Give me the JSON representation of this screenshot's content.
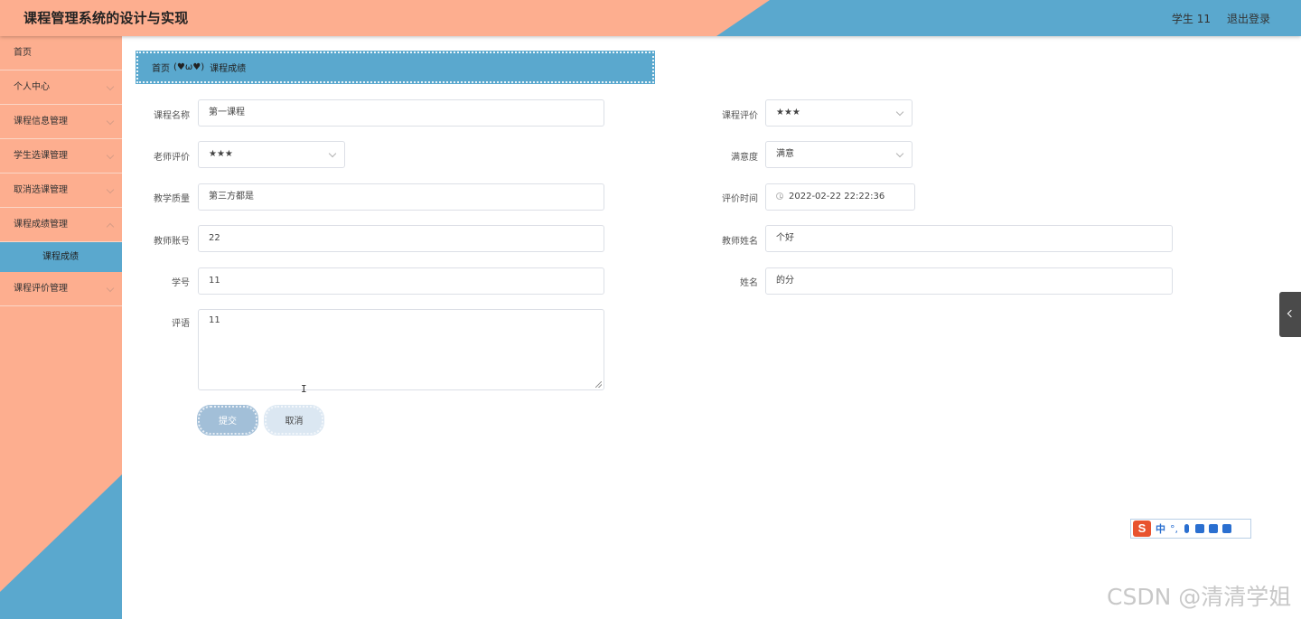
{
  "header": {
    "title": "课程管理系统的设计与实现",
    "user_label": "学生 11",
    "logout_label": "退出登录"
  },
  "sidebar": {
    "items": [
      {
        "label": "首页"
      },
      {
        "label": "个人中心"
      },
      {
        "label": "课程信息管理"
      },
      {
        "label": "学生选课管理"
      },
      {
        "label": "取消选课管理"
      },
      {
        "label": "课程成绩管理"
      },
      {
        "label": "课程成绩"
      },
      {
        "label": "课程评价管理"
      }
    ]
  },
  "breadcrumb": {
    "home": "首页",
    "separator": "(♥ω♥)",
    "current": "课程成绩"
  },
  "form": {
    "course_name": {
      "label": "课程名称",
      "value": "第一课程"
    },
    "course_rating": {
      "label": "课程评价",
      "value": "★★★"
    },
    "teacher_rating": {
      "label": "老师评价",
      "value": "★★★"
    },
    "satisfaction": {
      "label": "满意度",
      "value": "满意"
    },
    "teaching_quality": {
      "label": "教学质量",
      "value": "第三方都是"
    },
    "rating_time": {
      "label": "评价时间",
      "value": "2022-02-22 22:22:36"
    },
    "teacher_account": {
      "label": "教师账号",
      "value": "22"
    },
    "teacher_name": {
      "label": "教师姓名",
      "value": "个好"
    },
    "student_id": {
      "label": "学号",
      "value": "11"
    },
    "student_name": {
      "label": "姓名",
      "value": "的分"
    },
    "comment": {
      "label": "评语",
      "value": "11"
    },
    "submit_label": "提交",
    "cancel_label": "取消"
  },
  "ime_toolbar": {
    "logo": "S",
    "mode": "中",
    "punct": "°,"
  },
  "watermark": "CSDN @清清学姐",
  "colors": {
    "salmon": "#fdae8f",
    "blue": "#5aa8ce"
  }
}
